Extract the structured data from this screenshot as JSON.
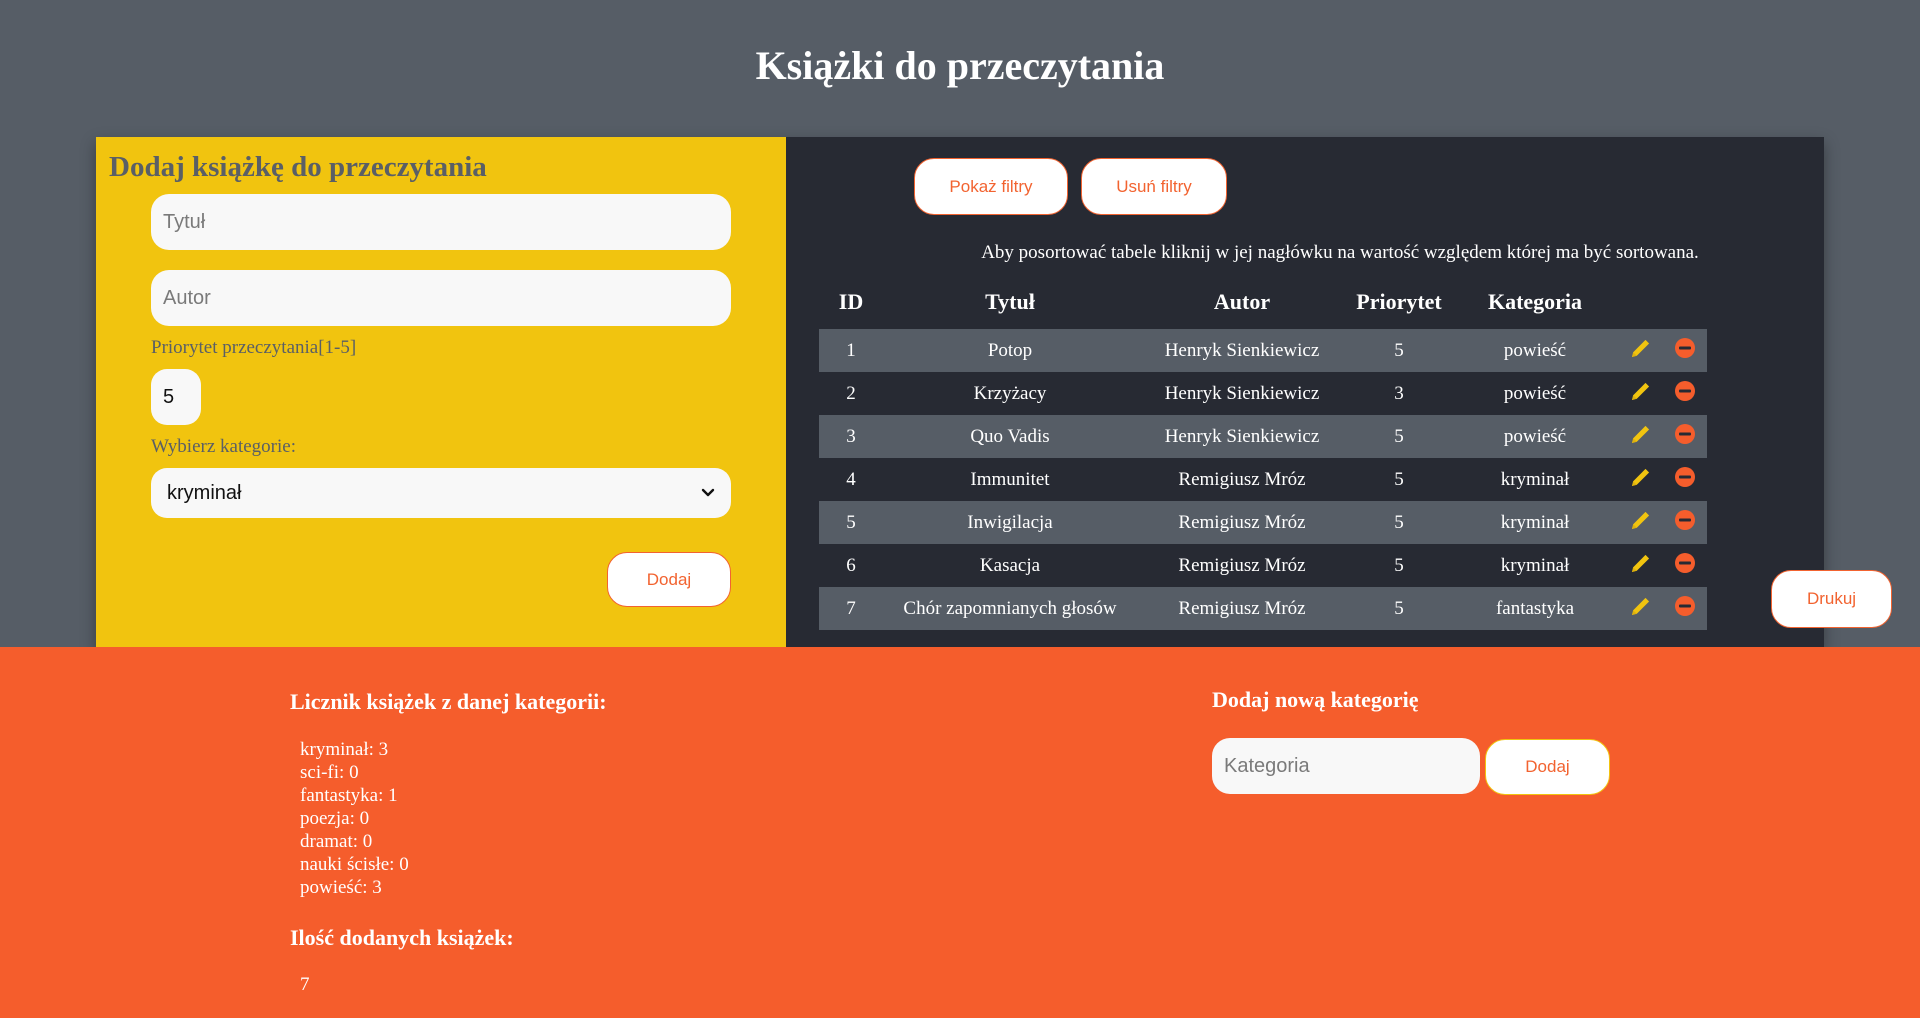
{
  "page": {
    "title": "Książki do przeczytania"
  },
  "form": {
    "title": "Dodaj książkę do przeczytania",
    "title_placeholder": "Tytuł",
    "author_placeholder": "Autor",
    "priority_label": "Priorytet przeczytania[1-5]",
    "priority_value": "5",
    "category_label": "Wybierz kategorie:",
    "category_selected": "kryminał",
    "add_button": "Dodaj"
  },
  "filters": {
    "show_button": "Pokaż filtry",
    "remove_button": "Usuń filtry"
  },
  "table": {
    "sort_hint": "Aby posortować tabele kliknij w jej nagłówku na wartość względem której ma być sortowana.",
    "headers": {
      "id": "ID",
      "title": "Tytuł",
      "author": "Autor",
      "priority": "Priorytet",
      "category": "Kategoria"
    },
    "rows": [
      {
        "id": "1",
        "title": "Potop",
        "author": "Henryk Sienkiewicz",
        "priority": "5",
        "category": "powieść"
      },
      {
        "id": "2",
        "title": "Krzyżacy",
        "author": "Henryk Sienkiewicz",
        "priority": "3",
        "category": "powieść"
      },
      {
        "id": "3",
        "title": "Quo Vadis",
        "author": "Henryk Sienkiewicz",
        "priority": "5",
        "category": "powieść"
      },
      {
        "id": "4",
        "title": "Immunitet",
        "author": "Remigiusz Mróz",
        "priority": "5",
        "category": "kryminał"
      },
      {
        "id": "5",
        "title": "Inwigilacja",
        "author": "Remigiusz Mróz",
        "priority": "5",
        "category": "kryminał"
      },
      {
        "id": "6",
        "title": "Kasacja",
        "author": "Remigiusz Mróz",
        "priority": "5",
        "category": "kryminał"
      },
      {
        "id": "7",
        "title": "Chór zapomnianych głosów",
        "author": "Remigiusz Mróz",
        "priority": "5",
        "category": "fantastyka"
      }
    ],
    "edit_icon": "pencil-icon",
    "delete_icon": "minus-circle-icon",
    "print_button": "Drukuj"
  },
  "counter": {
    "title": "Licznik książek z danej kategorii:",
    "items": [
      "kryminał: 3",
      "sci-fi: 0",
      "fantastyka: 1",
      "poezja: 0",
      "dramat: 0",
      "nauki ścisłe: 0",
      "powieść: 3"
    ],
    "total_title": "Ilość dodanych książek:",
    "total_value": "7"
  },
  "new_category": {
    "title": "Dodaj nową kategorię",
    "placeholder": "Kategoria",
    "button": "Dodaj"
  },
  "colors": {
    "background": "#565d66",
    "form_panel": "#f1c40f",
    "table_panel": "#272a33",
    "footer": "#f55d2c",
    "accent": "#f26330",
    "edit_icon": "#f1c40f",
    "delete_icon": "#f55d2c"
  }
}
